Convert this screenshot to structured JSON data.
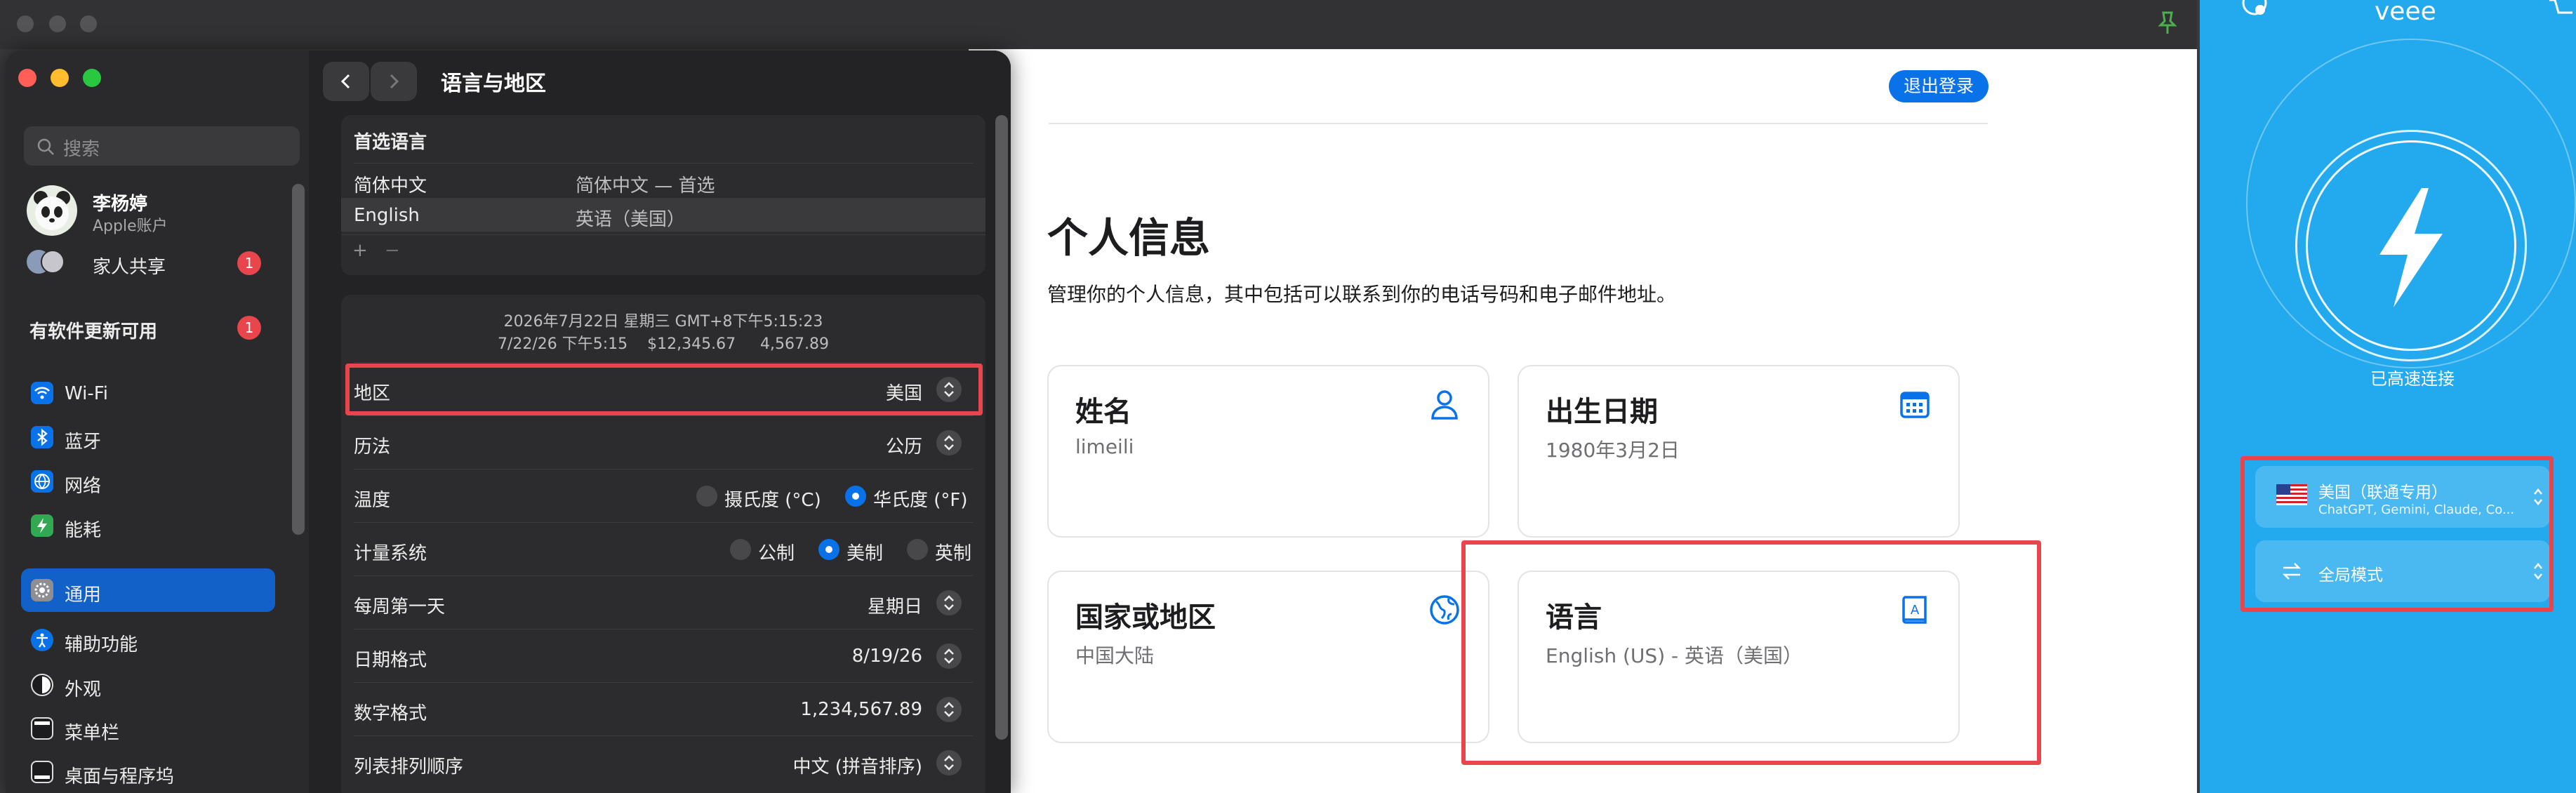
{
  "colors": {
    "accent": "#0a72e8",
    "highlight_box": "#e8454d",
    "veee_bg": "#23a9ee",
    "badge": "#e8454d"
  },
  "web": {
    "logout_label": "退出登录",
    "title": "个人信息",
    "description": "管理你的个人信息，其中包括可以联系到你的电话号码和电子邮件地址。",
    "cards": [
      {
        "title": "姓名",
        "value": "limeili",
        "icon": "person-icon"
      },
      {
        "title": "出生日期",
        "value": "1980年3月2日",
        "icon": "calendar-icon"
      },
      {
        "title": "国家或地区",
        "value": "中国大陆",
        "icon": "globe-icon"
      },
      {
        "title": "语言",
        "value": "English (US) - 英语（美国）",
        "icon": "book-icon"
      }
    ]
  },
  "veee": {
    "app_title": "veee",
    "status": "已高速连接",
    "location": {
      "title": "美国（联通专用）",
      "subtitle": "ChatGPT, Gemini, Claude, Co...",
      "icon": "us-flag-icon"
    },
    "mode": {
      "title": "全局模式",
      "icon": "swap-arrows-icon"
    }
  },
  "settings": {
    "title": "语言与地区",
    "search_placeholder": "搜索",
    "user": {
      "name": "李杨婷",
      "subtitle": "Apple账户"
    },
    "family": {
      "label": "家人共享",
      "badge": "1"
    },
    "update": {
      "label": "有软件更新可用",
      "badge": "1"
    },
    "sidebar_items": [
      {
        "label": "Wi-Fi",
        "icon": "wifi-icon",
        "color": "#0a72e8"
      },
      {
        "label": "蓝牙",
        "icon": "bluetooth-icon",
        "color": "#0a72e8"
      },
      {
        "label": "网络",
        "icon": "globe-icon",
        "color": "#0a72e8"
      },
      {
        "label": "能耗",
        "icon": "bolt-icon",
        "color": "#32a852"
      },
      {
        "label": "通用",
        "icon": "gear-icon",
        "color": "#8e8e93"
      },
      {
        "label": "辅助功能",
        "icon": "accessibility-icon",
        "color": "#0a72e8"
      },
      {
        "label": "外观",
        "icon": "appearance-icon",
        "color": "#1c1c1e"
      },
      {
        "label": "菜单栏",
        "icon": "menubar-icon",
        "color": "#1c1c1e"
      },
      {
        "label": "桌面与程序坞",
        "icon": "dock-icon",
        "color": "#1c1c1e"
      }
    ],
    "preferred_languages": {
      "header": "首选语言",
      "rows": [
        {
          "lang": "简体中文",
          "desc": "简体中文 — 首选"
        },
        {
          "lang": "English",
          "desc": "英语（美国）"
        }
      ],
      "add_label": "+",
      "remove_label": "−"
    },
    "preview": {
      "line1": "2026年7月22日 星期三 GMT+8下午5:15:23",
      "line2": "7/22/26 下午5:15    $12,345.67     4,567.89"
    },
    "rows": {
      "region": {
        "label": "地区",
        "value": "美国"
      },
      "calendar": {
        "label": "历法",
        "value": "公历"
      },
      "temperature": {
        "label": "温度",
        "celsius": "摄氏度 (°C)",
        "fahrenheit": "华氏度 (°F)"
      },
      "measurement": {
        "label": "计量系统",
        "metric": "公制",
        "us": "美制",
        "uk": "英制"
      },
      "first_day": {
        "label": "每周第一天",
        "value": "星期日"
      },
      "date_format": {
        "label": "日期格式",
        "value": "8/19/26"
      },
      "number_format": {
        "label": "数字格式",
        "value": "1,234,567.89"
      },
      "list_sort": {
        "label": "列表排列顺序",
        "value": "中文 (拼音排序)"
      }
    }
  }
}
